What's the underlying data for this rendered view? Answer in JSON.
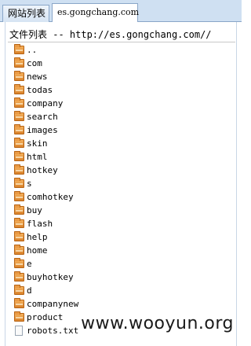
{
  "tabs": [
    {
      "label": "网站列表",
      "active": false
    },
    {
      "label": "es.gongchang.com",
      "active": true
    }
  ],
  "header": {
    "text": "文件列表 -- http://es.gongchang.com//"
  },
  "entries": [
    {
      "name": "..",
      "type": "folder"
    },
    {
      "name": "com",
      "type": "folder"
    },
    {
      "name": "news",
      "type": "folder"
    },
    {
      "name": "todas",
      "type": "folder"
    },
    {
      "name": "company",
      "type": "folder"
    },
    {
      "name": "search",
      "type": "folder"
    },
    {
      "name": "images",
      "type": "folder"
    },
    {
      "name": "skin",
      "type": "folder"
    },
    {
      "name": "html",
      "type": "folder"
    },
    {
      "name": "hotkey",
      "type": "folder"
    },
    {
      "name": "s",
      "type": "folder"
    },
    {
      "name": "comhotkey",
      "type": "folder"
    },
    {
      "name": "buy",
      "type": "folder"
    },
    {
      "name": "flash",
      "type": "folder"
    },
    {
      "name": "help",
      "type": "folder"
    },
    {
      "name": "home",
      "type": "folder"
    },
    {
      "name": "e",
      "type": "folder"
    },
    {
      "name": "buyhotkey",
      "type": "folder"
    },
    {
      "name": "d",
      "type": "folder"
    },
    {
      "name": "companynew",
      "type": "folder"
    },
    {
      "name": "product",
      "type": "folder"
    },
    {
      "name": "robots.txt",
      "type": "file"
    }
  ],
  "watermark": "www.wooyun.org",
  "colors": {
    "tabbar_bg": "#cfe0f2",
    "folder_orange": "#d9822b"
  }
}
